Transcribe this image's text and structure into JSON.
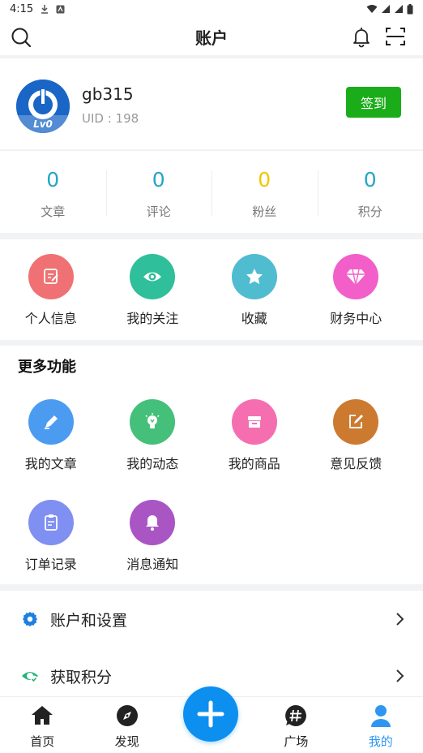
{
  "status_bar": {
    "time": "4:15"
  },
  "header": {
    "title": "账户"
  },
  "profile": {
    "username": "gb315",
    "uid": "UID : 198",
    "level": "Lv0",
    "checkin_label": "签到"
  },
  "stats": [
    {
      "value": "0",
      "label": "文章",
      "color": "#23a6c7"
    },
    {
      "value": "0",
      "label": "评论",
      "color": "#23a6c7"
    },
    {
      "value": "0",
      "label": "粉丝",
      "color": "#f5c400"
    },
    {
      "value": "0",
      "label": "积分",
      "color": "#23a6c7"
    }
  ],
  "quick_actions": [
    {
      "label": "个人信息",
      "icon": "edit-icon",
      "color": "#f07173"
    },
    {
      "label": "我的关注",
      "icon": "eye-icon",
      "color": "#2fbf9a"
    },
    {
      "label": "收藏",
      "icon": "star-icon",
      "color": "#4fbcd0"
    },
    {
      "label": "财务中心",
      "icon": "diamond-icon",
      "color": "#f25fc9"
    }
  ],
  "more_functions": {
    "title": "更多功能",
    "items": [
      {
        "label": "我的文章",
        "icon": "pencil-icon",
        "color": "#4b9cf0"
      },
      {
        "label": "我的动态",
        "icon": "lightbulb-icon",
        "color": "#44c07a"
      },
      {
        "label": "我的商品",
        "icon": "shop-icon",
        "color": "#f56fb0"
      },
      {
        "label": "意见反馈",
        "icon": "feedback-icon",
        "color": "#cc7a30"
      },
      {
        "label": "订单记录",
        "icon": "clipboard-icon",
        "color": "#7f8ff2"
      },
      {
        "label": "消息通知",
        "icon": "bell-icon",
        "color": "#a955c4"
      }
    ]
  },
  "menu": [
    {
      "label": "账户和设置",
      "icon": "gear-icon",
      "color": "#1e7fe0"
    },
    {
      "label": "获取积分",
      "icon": "eye-points-icon",
      "color": "#22b47a"
    }
  ],
  "tabs": [
    {
      "label": "首页",
      "icon": "home-icon"
    },
    {
      "label": "发现",
      "icon": "compass-icon"
    },
    {
      "label": "",
      "icon": "plus-icon"
    },
    {
      "label": "广场",
      "icon": "hash-chat-icon"
    },
    {
      "label": "我的",
      "icon": "user-icon",
      "active": true
    }
  ],
  "colors": {
    "accent": "#0d8ff0",
    "checkin": "#1aad19",
    "active_tab": "#2e96f0"
  }
}
